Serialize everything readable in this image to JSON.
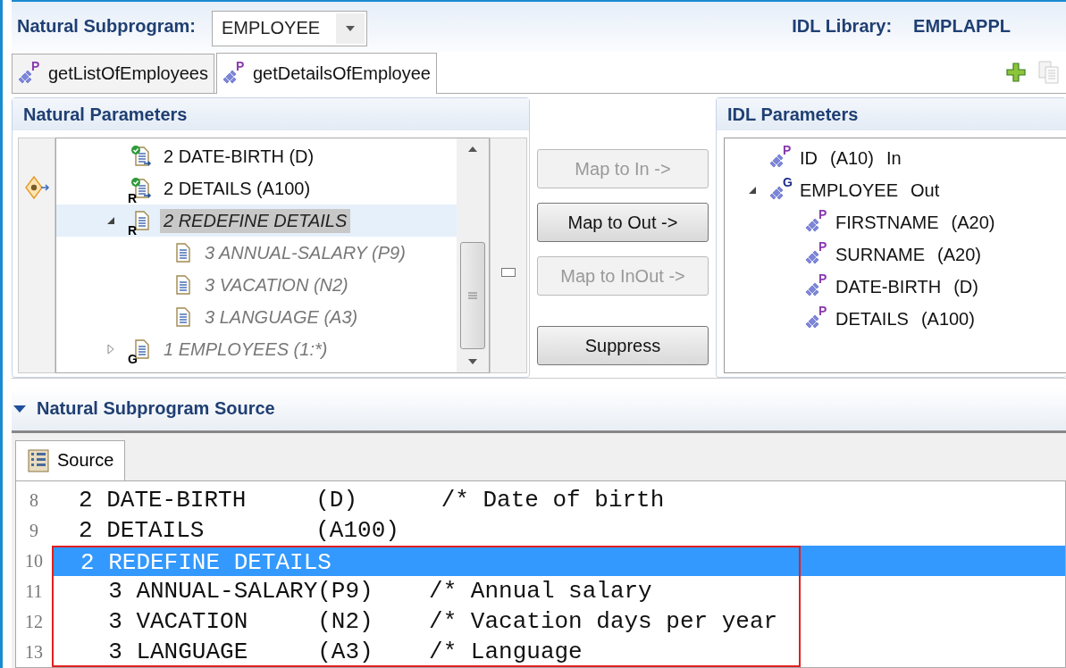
{
  "header": {
    "subprogram_label": "Natural Subprogram:",
    "subprogram": "EMPLOYEE",
    "library_label": "IDL Library:",
    "library": "EMPLAPPL"
  },
  "tabs": [
    {
      "label": "getListOfEmployees",
      "badge": "P",
      "selected": false
    },
    {
      "label": "getDetailsOfEmployee",
      "badge": "P",
      "selected": true
    }
  ],
  "natural_parameters": {
    "title": "Natural Parameters",
    "items": [
      {
        "text": "2 DATE-BIRTH (D)",
        "mapped": true,
        "selected": false
      },
      {
        "text": "2 DETAILS (A100)",
        "mapped": true,
        "badge": "R",
        "selected": false
      },
      {
        "text": "2 REDEFINE DETAILS",
        "mapped": false,
        "badge": "R",
        "selected": true,
        "expanded": true,
        "children": [
          {
            "text": "3 ANNUAL-SALARY (P9)",
            "mapped": false,
            "selected": false
          },
          {
            "text": "3 VACATION (N2)",
            "mapped": false,
            "selected": false
          },
          {
            "text": "3 LANGUAGE (A3)",
            "mapped": false,
            "selected": false
          }
        ]
      },
      {
        "text": "1 EMPLOYEES (1:*)",
        "mapped": false,
        "badge": "G",
        "selected": false,
        "expanded": false
      }
    ]
  },
  "buttons": [
    {
      "label": "Map to In ->",
      "disabled": true
    },
    {
      "label": "Map to Out ->",
      "disabled": false
    },
    {
      "label": "Map to InOut ->",
      "disabled": true
    },
    {
      "label": "Suppress",
      "disabled": false
    }
  ],
  "idl_parameters": {
    "title": "IDL Parameters",
    "items": [
      {
        "badge": "P",
        "name": "ID",
        "type": "(A10)",
        "direction": "In"
      },
      {
        "badge": "G",
        "name": "EMPLOYEE",
        "direction": "Out",
        "expanded": true,
        "children": [
          {
            "badge": "P",
            "name": "FIRSTNAME",
            "type": "(A20)"
          },
          {
            "badge": "P",
            "name": "SURNAME",
            "type": "(A20)"
          },
          {
            "badge": "P",
            "name": "DATE-BIRTH",
            "type": "(D)"
          },
          {
            "badge": "P",
            "name": "DETAILS",
            "type": "(A100)"
          }
        ]
      }
    ]
  },
  "source_section": {
    "title": "Natural Subprogram Source",
    "expanded": true,
    "tab": "Source",
    "lines": [
      {
        "number": "8",
        "text": "2 DATE-BIRTH     (D)      /* Date of birth",
        "selected": false,
        "boxed": false
      },
      {
        "number": "9",
        "text": "2 DETAILS        (A100)",
        "selected": false,
        "boxed": false
      },
      {
        "number": "10",
        "text": "2 REDEFINE DETAILS",
        "selected": true,
        "boxed": true
      },
      {
        "number": "11",
        "text": "  3 ANNUAL-SALARY(P9)    /* Annual salary",
        "selected": false,
        "boxed": true
      },
      {
        "number": "12",
        "text": "  3 VACATION     (N2)    /* Vacation days per year",
        "selected": false,
        "boxed": true
      },
      {
        "number": "13",
        "text": "  3 LANGUAGE     (A3)    /* Language",
        "selected": false,
        "boxed": true
      }
    ]
  }
}
